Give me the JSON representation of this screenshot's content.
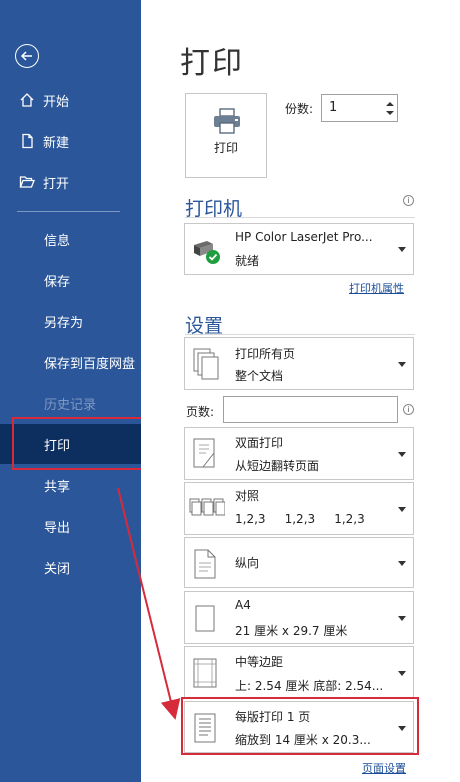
{
  "sidebar": {
    "back_icon": "back-arrow-icon",
    "items": [
      {
        "label": "开始",
        "icon": "home-icon"
      },
      {
        "label": "新建",
        "icon": "new-document-icon"
      },
      {
        "label": "打开",
        "icon": "folder-open-icon"
      },
      {
        "label": "信息"
      },
      {
        "label": "保存"
      },
      {
        "label": "另存为"
      },
      {
        "label": "保存到百度网盘"
      },
      {
        "label": "历史记录",
        "disabled": true
      },
      {
        "label": "打印",
        "active": true
      },
      {
        "label": "共享"
      },
      {
        "label": "导出"
      },
      {
        "label": "关闭"
      }
    ]
  },
  "main": {
    "title": "打印",
    "print_button_label": "打印",
    "copies_label": "份数:",
    "copies_value": "1",
    "printer_section": {
      "heading": "打印机",
      "printer_name": "HP Color LaserJet Pro...",
      "printer_status": "就绪",
      "properties_link": "打印机属性"
    },
    "settings_section": {
      "heading": "设置",
      "print_range": {
        "line1": "打印所有页",
        "line2": "整个文档"
      },
      "pages_label": "页数:",
      "pages_value": "",
      "duplex": {
        "line1": "双面打印",
        "line2": "从短边翻转页面"
      },
      "collate": {
        "line1": "对照",
        "line2": "1,2,3     1,2,3     1,2,3"
      },
      "orientation": {
        "line1": "纵向"
      },
      "paper": {
        "line1": "A4",
        "line2": "21 厘米 x 29.7 厘米"
      },
      "margins": {
        "line1": "中等边距",
        "line2": "上: 2.54 厘米 底部: 2.54..."
      },
      "pages_per_sheet": {
        "line1": "每版打印 1 页",
        "line2": "缩放到 14 厘米 x 20.3..."
      },
      "page_setup_link": "页面设置"
    }
  },
  "colors": {
    "sidebar_bg": "#2b579a",
    "sidebar_active_bg": "#0d2f5f",
    "accent": "#2b579a",
    "annotation_red": "#d52b3a"
  }
}
